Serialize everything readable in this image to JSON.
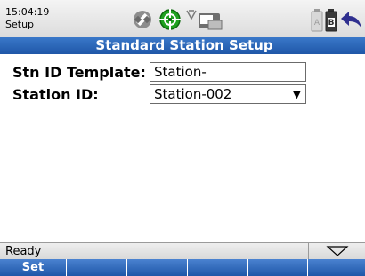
{
  "status_bar": {
    "time": "15:04:19",
    "app_name": "Setup",
    "icons": [
      "satellite-icon",
      "gnss-target-icon",
      "radio-link-icon",
      "controller-icon",
      "battery-a-icon",
      "battery-b-icon",
      "back-arrow-icon"
    ]
  },
  "title": "Standard Station Setup",
  "form": {
    "template_label": "Stn ID Template:",
    "template_value": "Station-",
    "station_label": "Station ID:",
    "station_value": "Station-002"
  },
  "status": {
    "text": "Ready"
  },
  "softkeys": [
    "Set",
    "",
    "",
    "",
    "",
    ""
  ],
  "colors": {
    "title_bar": "#1f57a8",
    "softkey_bar": "#2d63b3",
    "target_green": "#1fa21f",
    "back_arrow": "#2f2f8f"
  }
}
